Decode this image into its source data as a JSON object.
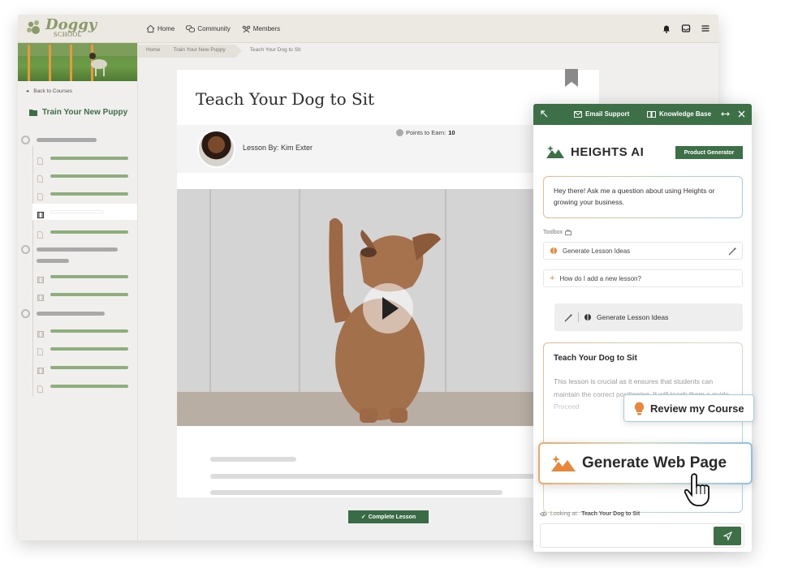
{
  "logo": {
    "line1": "Doggy",
    "line2": "SCHOOL"
  },
  "nav": {
    "home": "Home",
    "community": "Community",
    "members": "Members"
  },
  "sidebar": {
    "back_label": "Back to Courses",
    "course_title": "Train Your New Puppy"
  },
  "breadcrumb": {
    "home": "Home",
    "course": "Train Your New Puppy",
    "current": "Teach Your Dog to Sit"
  },
  "lesson": {
    "title": "Teach Your Dog to Sit",
    "by_label": "Lesson By: Kim Exter",
    "points_label": "Points to Earn:",
    "points_value": "10",
    "complete_label": "Complete Lesson"
  },
  "ai_panel": {
    "email_support": "Email Support",
    "knowledge_base": "Knowledge Base",
    "brand": "HEIGHTS AI",
    "product_generator": "Product Generator",
    "greeting": "Hey there! Ask me a question about using Heights or growing your business.",
    "toolbox_label": "Toolbox",
    "tool1": "Generate Lesson Ideas",
    "tool2": "How do I add a new lesson?",
    "generate_button": "Generate Lesson Ideas",
    "card_title": "Teach Your Dog to Sit",
    "card_body": "This lesson is crucial as it ensures that students can maintain the correct positioning. It will teach them a guide. Proceed",
    "looking_label": "Looking at:",
    "looking_value": "Teach Your Dog to Sit",
    "chat_placeholder": ""
  },
  "callouts": {
    "review": "Review my Course",
    "generate_web": "Generate Web Page"
  },
  "colors": {
    "brand_green": "#3e7047",
    "lesson_bar_green": "#8fae7e",
    "accent_orange": "#e8863a"
  }
}
